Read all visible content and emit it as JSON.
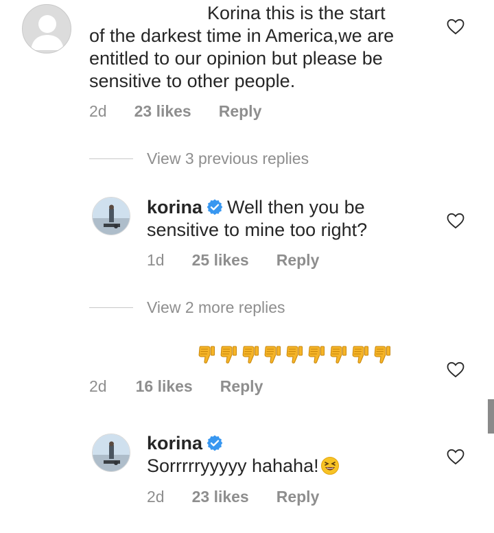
{
  "comments": [
    {
      "text": "Korina this is the start of the darkest time in America,we are entitled to our opinion but please be sensitive to other people.",
      "line1": "Korina this is the start",
      "line2": "of the darkest time in America,we are",
      "line3": "entitled to our opinion but please be",
      "line4": "sensitive to other people.",
      "age": "2d",
      "likes": "23 likes",
      "reply_label": "Reply",
      "view_replies": "View 3 previous replies"
    },
    {
      "username": "korina",
      "line1": "Well then you be",
      "line2": "sensitive to mine too right?",
      "age": "1d",
      "likes": "25 likes",
      "reply_label": "Reply",
      "view_replies": "View 2 more replies"
    },
    {
      "emoji_text": "👎👎👎👎👎👎👎👎👎",
      "emoji_count": 9,
      "age": "2d",
      "likes": "16 likes",
      "reply_label": "Reply"
    },
    {
      "username": "korina",
      "text": "Sorrrrryyyyy hahaha!",
      "emoji": "😆",
      "age": "2d",
      "likes": "23 likes",
      "reply_label": "Reply"
    }
  ],
  "colors": {
    "text": "#262626",
    "meta": "#8e8e8e",
    "verified": "#3897f0",
    "thumbs": "#f5b428"
  },
  "icons": {
    "like": "heart-outline-icon",
    "verified": "verified-badge-icon",
    "avatar_default": "default-avatar-icon"
  }
}
